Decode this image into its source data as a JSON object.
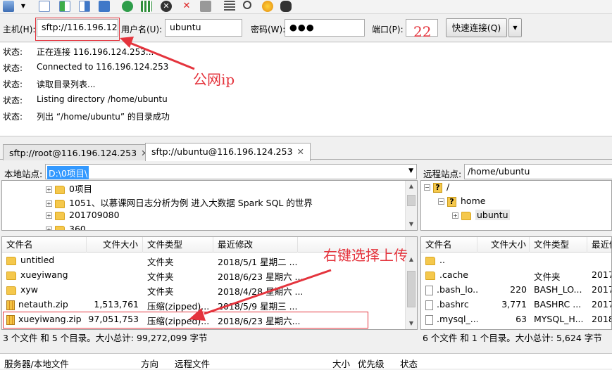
{
  "toolbar": {
    "icons": [
      "site-manager-icon",
      "dropdown-arrow-icon",
      "toggle-log-icon",
      "toggle-local-tree-icon",
      "toggle-remote-tree-icon",
      "toggle-queue-icon",
      "refresh-icon",
      "process-queue-icon",
      "cancel-icon",
      "disconnect-icon",
      "reconnect-icon",
      "filter-icon",
      "search-icon",
      "compare-icon",
      "binoculars-icon"
    ]
  },
  "quickconnect": {
    "host_label": "主机(H):",
    "host_value": "sftp://116.196.124",
    "user_label": "用户名(U):",
    "user_value": "ubuntu",
    "pass_label": "密码(W):",
    "pass_value": "●●●",
    "port_label": "端口(P):",
    "port_value": "22",
    "connect_label": "快速连接(Q)",
    "dropdown": "▼"
  },
  "log": [
    {
      "status": "状态:",
      "message": "正在连接 116.196.124.253..."
    },
    {
      "status": "状态:",
      "message": "Connected to 116.196.124.253"
    },
    {
      "status": "状态:",
      "message": "读取目录列表..."
    },
    {
      "status": "状态:",
      "message": "Listing directory /home/ubuntu"
    },
    {
      "status": "状态:",
      "message": "列出 “/home/ubuntu” 的目录成功"
    }
  ],
  "tabs": [
    {
      "label": "sftp://root@116.196.124.253",
      "close": "✕"
    },
    {
      "label": "sftp://ubuntu@116.196.124.253",
      "close": "✕"
    }
  ],
  "local": {
    "site_label": "本地站点:",
    "site_path": "D:\\0项目\\",
    "tree": [
      "0项目",
      "1051、以慕课网日志分析为例 进入大数据 Spark SQL 的世界",
      "201709080",
      "360"
    ],
    "columns": [
      "文件名",
      "文件大小",
      "文件类型",
      "最近修改"
    ],
    "files": [
      {
        "name": "untitled",
        "size": "",
        "type": "文件夹",
        "modified": "2018/5/1 星期二 ...",
        "icon": "folder"
      },
      {
        "name": "xueyiwang",
        "size": "",
        "type": "文件夹",
        "modified": "2018/6/23 星期六 ...",
        "icon": "folder"
      },
      {
        "name": "xyw",
        "size": "",
        "type": "文件夹",
        "modified": "2018/4/28 星期六 ...",
        "icon": "folder"
      },
      {
        "name": "netauth.zip",
        "size": "1,513,761",
        "type": "压缩(zipped)...",
        "modified": "2018/5/9 星期三 ...",
        "icon": "zip"
      },
      {
        "name": "xueyiwang.zip",
        "size": "97,051,753",
        "type": "压缩(zipped)...",
        "modified": "2018/6/23 星期六...",
        "icon": "zip"
      }
    ],
    "status": "3 个文件 和 5 个目录。大小总计: 99,272,099 字节"
  },
  "remote": {
    "site_label": "远程站点:",
    "site_path": "/home/ubuntu",
    "tree": [
      {
        "label": "/",
        "expander": "⊟"
      },
      {
        "label": "home",
        "expander": "⊟"
      },
      {
        "label": "ubuntu",
        "expander": "⊞"
      }
    ],
    "columns": [
      "文件名",
      "文件大小",
      "文件类型",
      "最近修"
    ],
    "files": [
      {
        "name": "..",
        "size": "",
        "type": "",
        "modified": "",
        "icon": "folder"
      },
      {
        "name": ".cache",
        "size": "",
        "type": "文件夹",
        "modified": "2017/",
        "icon": "folder"
      },
      {
        "name": ".bash_lo...",
        "size": "220",
        "type": "BASH_LO...",
        "modified": "2017/",
        "icon": "file"
      },
      {
        "name": ".bashrc",
        "size": "3,771",
        "type": "BASHRC ...",
        "modified": "2017/",
        "icon": "file"
      },
      {
        "name": ".mysql_...",
        "size": "63",
        "type": "MYSQL_H...",
        "modified": "2018/",
        "icon": "file"
      }
    ],
    "status": "6 个文件 和 1 个目录。大小总计: 5,624 字节"
  },
  "queue": {
    "columns": [
      "服务器/本地文件",
      "方向",
      "远程文件",
      "大小",
      "优先级",
      "状态"
    ]
  },
  "annotations": {
    "public_ip": "公网ip",
    "right_click": "右键选择上传"
  },
  "colors": {
    "annotation": "#e4343d",
    "selection": "#3399ff"
  }
}
